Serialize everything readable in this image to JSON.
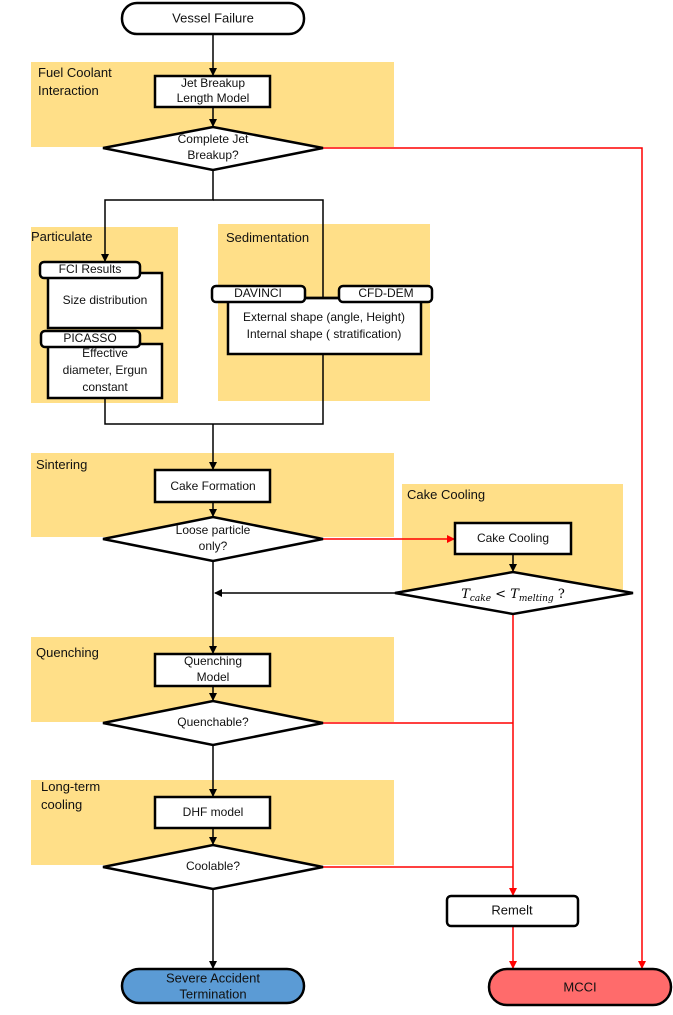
{
  "colors": {
    "region": "#ffdf88",
    "red_path": "#ff0000",
    "termination": "#5b9bd5",
    "mcci": "#ff6b6b"
  },
  "start": "Vessel Failure",
  "regions": {
    "fci": [
      "Fuel Coolant",
      "Interaction"
    ],
    "particulate": "Particulate",
    "sedimentation": "Sedimentation",
    "sintering": "Sintering",
    "cake_cooling": "Cake Cooling",
    "quenching": "Quenching",
    "long_term": [
      "Long-term",
      "cooling"
    ]
  },
  "boxes": {
    "jet_breakup": [
      "Jet Breakup",
      "Length Model"
    ],
    "fci_results_tab": "FCI Results",
    "size_distribution": "Size distribution",
    "picasso_tab": "PICASSO",
    "effective": [
      "Effective",
      "diameter, Ergun",
      "constant"
    ],
    "davinci_tab": "DAVINCI",
    "cfd_dem_tab": "CFD-DEM",
    "shape": [
      "External shape (angle, Height)",
      "Internal shape ( stratification)"
    ],
    "cake_formation": "Cake Formation",
    "cake_cooling": "Cake Cooling",
    "quenching_model": [
      "Quenching",
      "Model"
    ],
    "dhf_model": "DHF model",
    "remelt": "Remelt"
  },
  "decisions": {
    "complete_jet": [
      "Complete Jet",
      "Breakup?"
    ],
    "loose_particle": [
      "Loose particle",
      "only?"
    ],
    "t_cake": {
      "t": "T",
      "cake": "cake",
      "lt": " < ",
      "melting": "melting",
      "q": " ?"
    },
    "quenchable": "Quenchable?",
    "coolable": "Coolable?"
  },
  "ends": {
    "termination": [
      "Severe Accident",
      "Termination"
    ],
    "mcci": "MCCI"
  }
}
